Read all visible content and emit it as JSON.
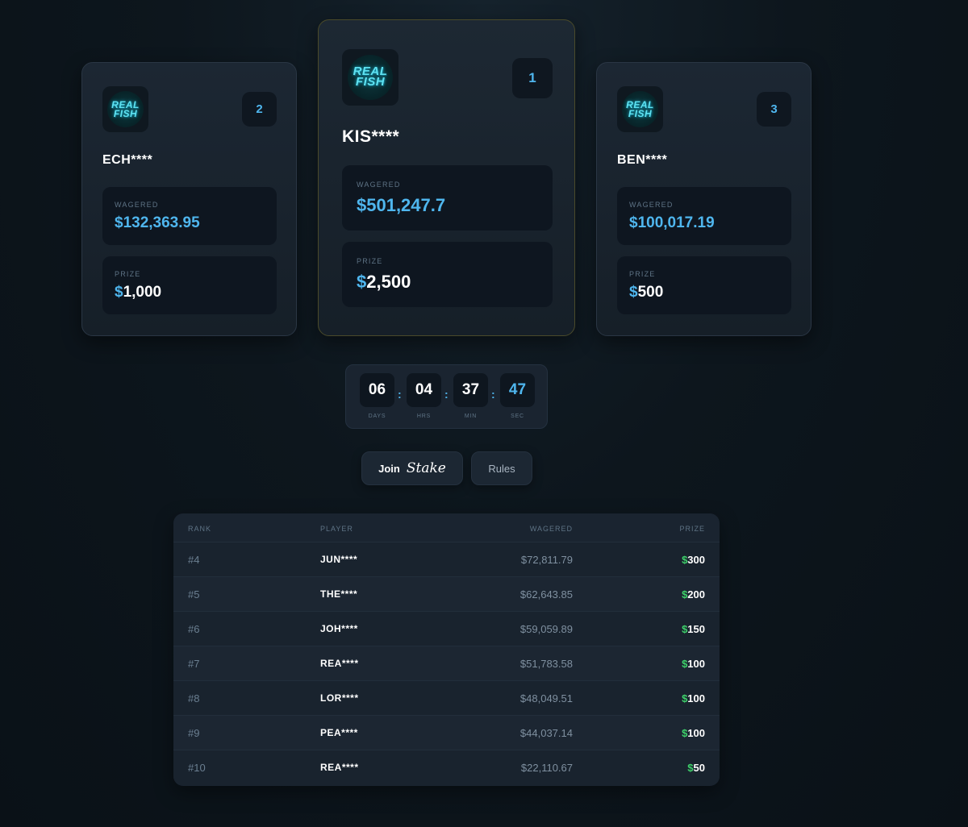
{
  "podium": [
    {
      "rank": "2",
      "player": "ECH****",
      "wagered_label": "WAGERED",
      "wagered": "$132,363.95",
      "prize_label": "PRIZE",
      "prize_symbol": "$",
      "prize": "1,000",
      "logo_line1": "REAL",
      "logo_line2": "FISH"
    },
    {
      "rank": "1",
      "player": "KIS****",
      "wagered_label": "WAGERED",
      "wagered": "$501,247.7",
      "prize_label": "PRIZE",
      "prize_symbol": "$",
      "prize": "2,500",
      "logo_line1": "REAL",
      "logo_line2": "FISH"
    },
    {
      "rank": "3",
      "player": "BEN****",
      "wagered_label": "WAGERED",
      "wagered": "$100,017.19",
      "prize_label": "PRIZE",
      "prize_symbol": "$",
      "prize": "500",
      "logo_line1": "REAL",
      "logo_line2": "FISH"
    }
  ],
  "countdown": {
    "days": "06",
    "days_label": "DAYS",
    "hrs": "04",
    "hrs_label": "HRS",
    "min": "37",
    "min_label": "MIN",
    "sec": "47",
    "sec_label": "SEC",
    "separator": ":"
  },
  "buttons": {
    "join_label": "Join",
    "join_brand": "Stake",
    "rules_label": "Rules"
  },
  "table": {
    "headers": {
      "rank": "RANK",
      "player": "PLAYER",
      "wagered": "WAGERED",
      "prize": "PRIZE"
    },
    "rows": [
      {
        "rank": "#4",
        "player": "JUN****",
        "wagered": "$72,811.79",
        "prize_symbol": "$",
        "prize": "300"
      },
      {
        "rank": "#5",
        "player": "THE****",
        "wagered": "$62,643.85",
        "prize_symbol": "$",
        "prize": "200"
      },
      {
        "rank": "#6",
        "player": "JOH****",
        "wagered": "$59,059.89",
        "prize_symbol": "$",
        "prize": "150"
      },
      {
        "rank": "#7",
        "player": "REA****",
        "wagered": "$51,783.58",
        "prize_symbol": "$",
        "prize": "100"
      },
      {
        "rank": "#8",
        "player": "LOR****",
        "wagered": "$48,049.51",
        "prize_symbol": "$",
        "prize": "100"
      },
      {
        "rank": "#9",
        "player": "PEA****",
        "wagered": "$44,037.14",
        "prize_symbol": "$",
        "prize": "100"
      },
      {
        "rank": "#10",
        "player": "REA****",
        "wagered": "$22,110.67",
        "prize_symbol": "$",
        "prize": "50"
      }
    ]
  },
  "colors": {
    "accent": "#4fb6ee",
    "prize_green": "#3ed06a",
    "background": "#0d161d",
    "card": "#1c2733"
  }
}
